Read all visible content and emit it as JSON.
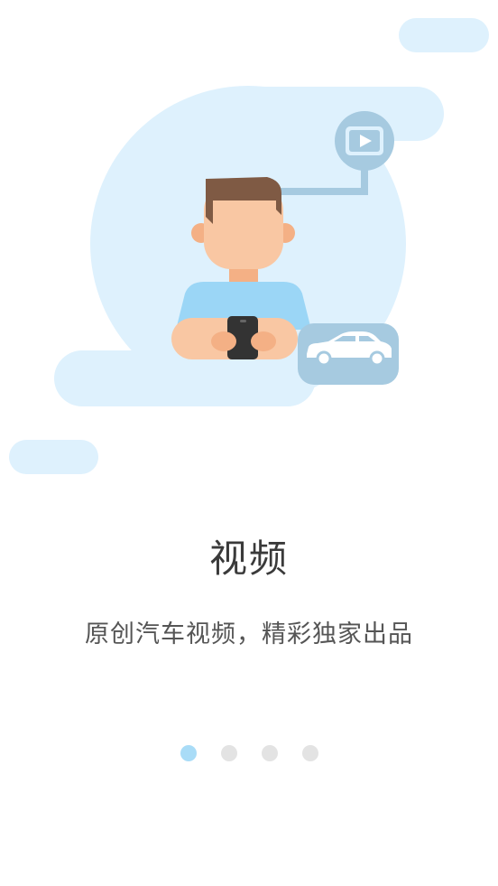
{
  "onboarding": {
    "title": "视频",
    "subtitle": "原创汽车视频，精彩独家出品",
    "pages": [
      {
        "label": "page-1",
        "active": true
      },
      {
        "label": "page-2",
        "active": false
      },
      {
        "label": "page-3",
        "active": false
      },
      {
        "label": "page-4",
        "active": false
      }
    ]
  },
  "illustration": {
    "subject": "person-watching-video-on-phone",
    "icons": [
      "play-icon",
      "car-icon",
      "phone-icon"
    ]
  },
  "colors": {
    "cloud": "#def1fd",
    "badge": "#a6cae0",
    "skin": "#f9c7a3",
    "hair": "#7f5a44",
    "shirt": "#9bd6f6",
    "phone": "#333333",
    "active_dot": "#a9dcf7",
    "inactive_dot": "#e3e3e3",
    "title_text": "#3a3a3a",
    "subtitle_text": "#555555"
  }
}
